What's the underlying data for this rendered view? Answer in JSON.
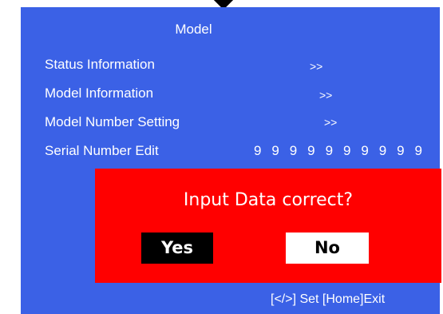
{
  "menu": {
    "title": "Model",
    "items": [
      {
        "label": "Status Information",
        "value": ">>"
      },
      {
        "label": "Model Information",
        "value": ">>"
      },
      {
        "label": "Model Number Setting",
        "value": ">>"
      },
      {
        "label": "Serial Number Edit",
        "value": ""
      }
    ],
    "serial_digits": [
      "9",
      "9",
      "9",
      "9",
      "9",
      "9",
      "9",
      "9",
      "9",
      "9"
    ]
  },
  "dialog": {
    "message": "Input Data correct?",
    "yes_label": "Yes",
    "no_label": "No"
  },
  "footer": {
    "hint": "[</>] Set [Home]Exit"
  },
  "colors": {
    "panel_bg": "#3b61e6",
    "dialog_bg": "#ff0000",
    "text": "#ffffff"
  }
}
